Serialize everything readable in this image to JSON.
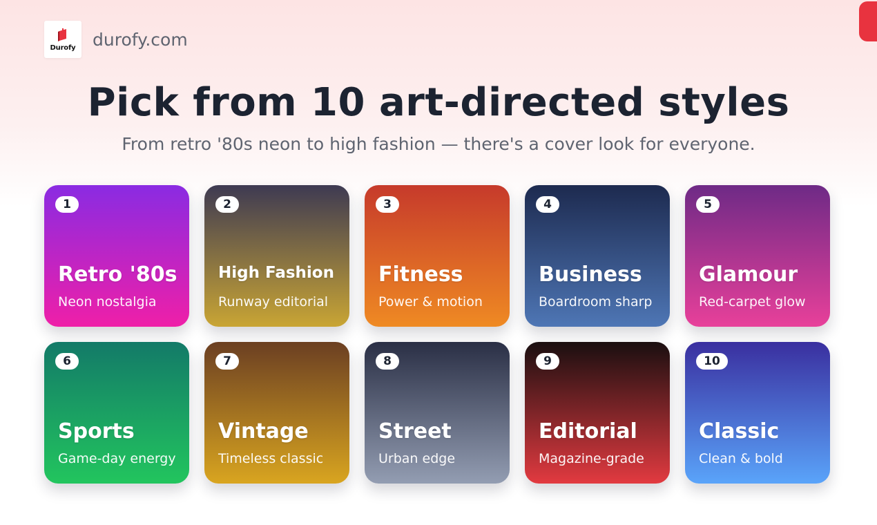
{
  "brand": {
    "logo_word": "Durofy",
    "site_url": "durofy.com",
    "accent_color": "#e8333f"
  },
  "hero": {
    "title": "Pick from 10 art-directed styles",
    "subtitle": "From retro '80s neon to high fashion — there's a cover look for everyone."
  },
  "styles": [
    {
      "number": "1",
      "name": "Retro '80s",
      "tagline": "Neon nostalgia",
      "colors": [
        "#8a2be2",
        "#ef1fa8"
      ]
    },
    {
      "number": "2",
      "name": "High Fashion",
      "tagline": "Runway editorial",
      "colors": [
        "#3e3a52",
        "#c9a534"
      ]
    },
    {
      "number": "3",
      "name": "Fitness",
      "tagline": "Power & motion",
      "colors": [
        "#c63a2b",
        "#ef8a23"
      ]
    },
    {
      "number": "4",
      "name": "Business",
      "tagline": "Boardroom sharp",
      "colors": [
        "#1d2a4f",
        "#4e76b5"
      ]
    },
    {
      "number": "5",
      "name": "Glamour",
      "tagline": "Red-carpet glow",
      "colors": [
        "#6e2a86",
        "#e8409a"
      ]
    },
    {
      "number": "6",
      "name": "Sports",
      "tagline": "Game-day energy",
      "colors": [
        "#137a68",
        "#22c55e"
      ]
    },
    {
      "number": "7",
      "name": "Vintage",
      "tagline": "Timeless classic",
      "colors": [
        "#6b3f22",
        "#d9a520"
      ]
    },
    {
      "number": "8",
      "name": "Street",
      "tagline": "Urban edge",
      "colors": [
        "#2a2f45",
        "#939db2"
      ]
    },
    {
      "number": "9",
      "name": "Editorial",
      "tagline": "Magazine-grade",
      "colors": [
        "#1a0f10",
        "#e23a40"
      ]
    },
    {
      "number": "10",
      "name": "Classic",
      "tagline": "Clean & bold",
      "colors": [
        "#3a2f9f",
        "#5aa4fa"
      ]
    }
  ]
}
